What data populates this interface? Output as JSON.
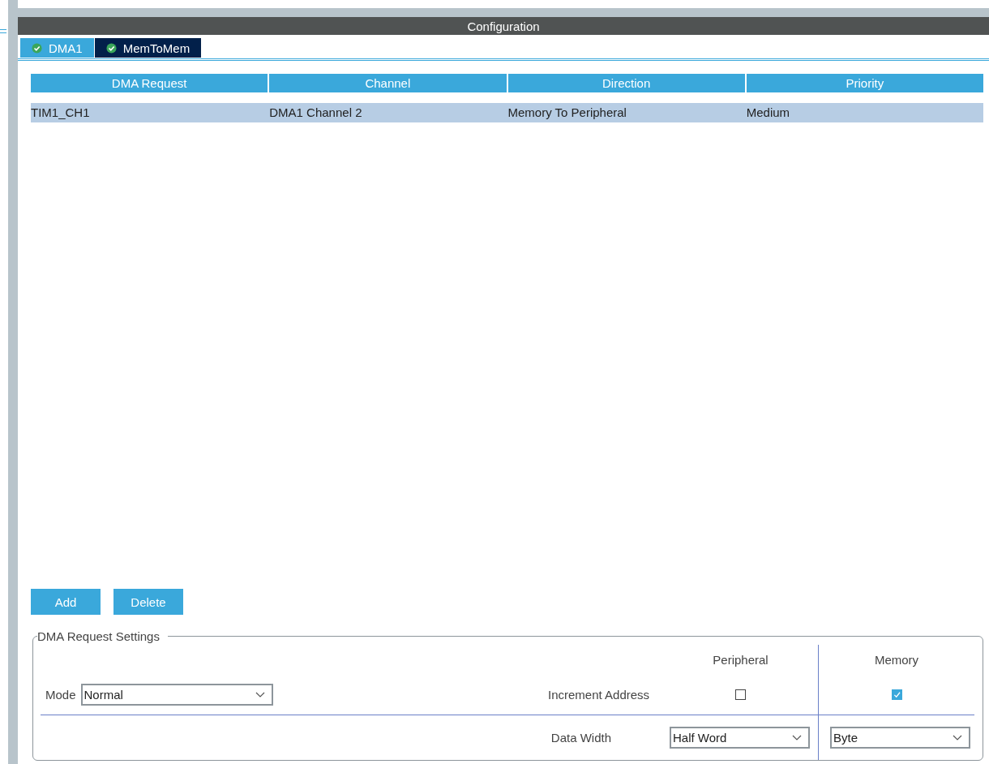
{
  "panel": {
    "title": "Configuration"
  },
  "tabs": [
    {
      "label": "DMA1",
      "selected": true
    },
    {
      "label": "MemToMem",
      "selected": false
    }
  ],
  "table": {
    "columns": [
      "DMA Request",
      "Channel",
      "Direction",
      "Priority"
    ],
    "rows": [
      {
        "cells": [
          "TIM1_CH1",
          "DMA1 Channel 2",
          "Memory To Peripheral",
          "Medium"
        ],
        "selected": true
      }
    ]
  },
  "buttons": [
    "Add",
    "Delete"
  ],
  "settings": {
    "title": "DMA Request Settings",
    "mode": {
      "label": "Mode",
      "value": "Normal"
    },
    "columns": [
      "Peripheral",
      "Memory"
    ],
    "increment": {
      "label": "Increment Address",
      "peripheral_checked": false,
      "memory_checked": true
    },
    "data_width": {
      "label": "Data Width",
      "peripheral": "Half Word",
      "memory": "Byte"
    }
  }
}
